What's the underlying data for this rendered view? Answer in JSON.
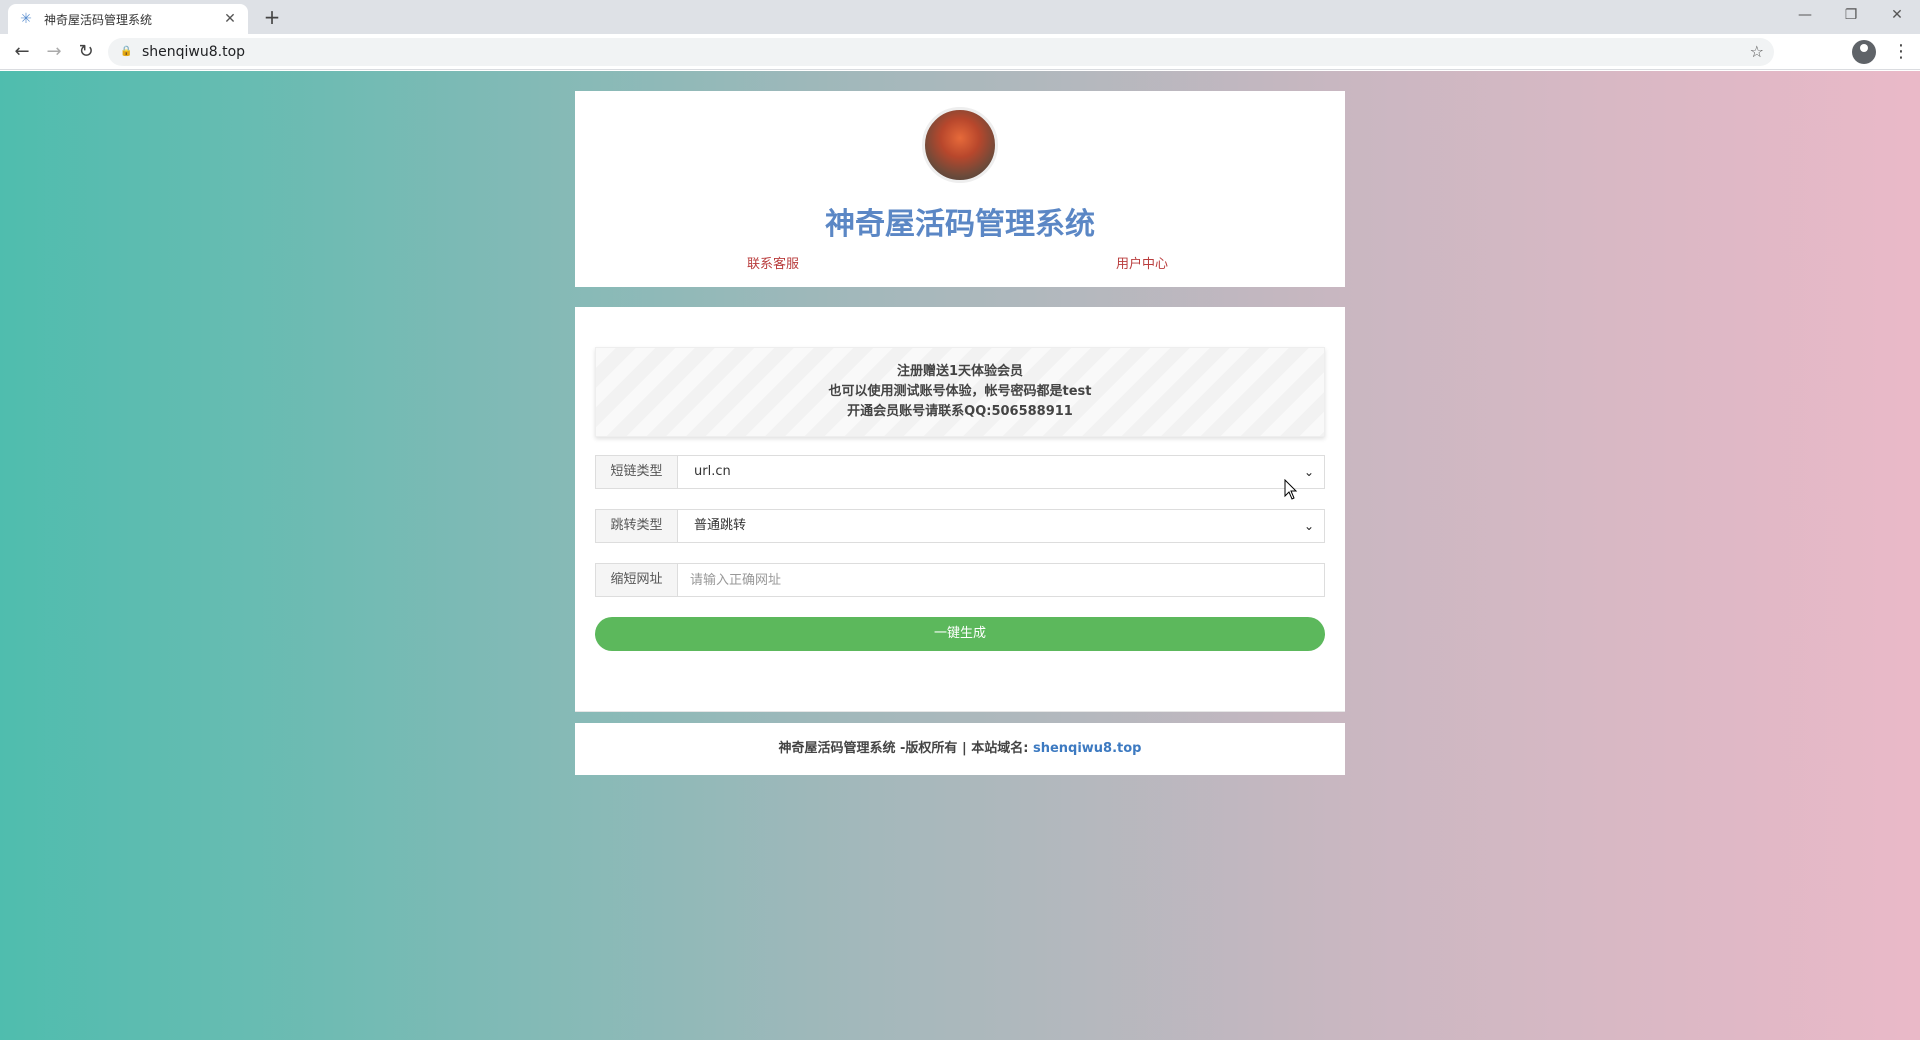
{
  "browser": {
    "tab_title": "神奇屋活码管理系统",
    "tab_close": "✕",
    "new_tab": "+",
    "url": "shenqiwu8.top",
    "window_controls": {
      "minimize": "—",
      "restore": "❐",
      "close": "✕"
    }
  },
  "header": {
    "title": "神奇屋活码管理系统",
    "links": [
      "联系客服",
      "用户中心"
    ]
  },
  "notice": {
    "lines": [
      "注册赠送1天体验会员",
      "也可以使用测试账号体验，帐号密码都是test",
      "开通会员账号请联系QQ:506588911"
    ]
  },
  "form": {
    "short_type": {
      "label": "短链类型",
      "value": "url.cn"
    },
    "jump_type": {
      "label": "跳转类型",
      "value": "普通跳转"
    },
    "url": {
      "label": "缩短网址",
      "placeholder": "请输入正确网址",
      "value": ""
    },
    "submit_label": "一键生成"
  },
  "footer": {
    "text": "神奇屋活码管理系统 -版权所有 | 本站域名: ",
    "domain": "shenqiwu8.top"
  },
  "colors": {
    "title_blue": "#5b87c5",
    "link_red": "#b93c3c",
    "button_green": "#5cb85c",
    "gradient_left": "#4fbdae",
    "gradient_right": "#eab9c8"
  }
}
